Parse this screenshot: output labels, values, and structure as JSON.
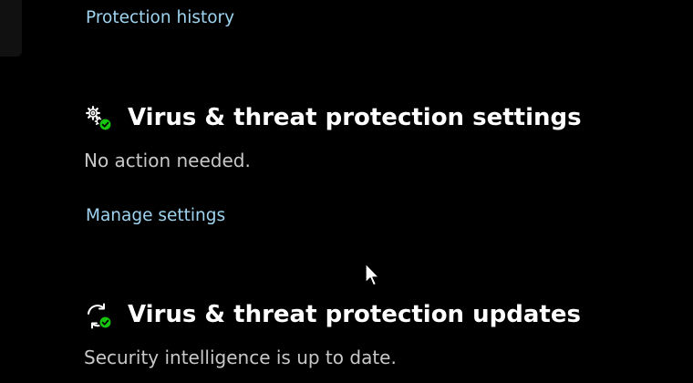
{
  "protection_history": {
    "link_label": "Protection history"
  },
  "settings_section": {
    "icon": "gears-with-check-icon",
    "title": "Virus & threat protection settings",
    "status": "No action needed.",
    "link_label": "Manage settings"
  },
  "updates_section": {
    "icon": "refresh-with-check-icon",
    "title": "Virus & threat protection updates",
    "status": "Security intelligence is up to date."
  },
  "colors": {
    "background": "#000000",
    "link": "#9fd4f0",
    "title": "#ffffff",
    "status_text": "#c8c8c8",
    "check_badge": "#16c60c"
  }
}
